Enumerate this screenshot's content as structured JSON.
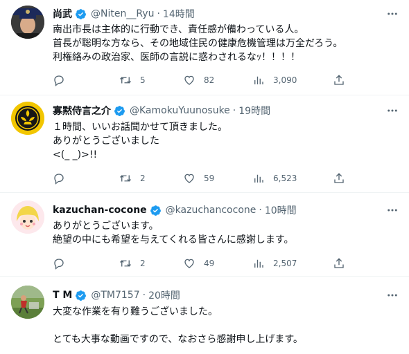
{
  "tweets": [
    {
      "name": "尚武",
      "handle": "@Niten__Ryu",
      "sep": "·",
      "time": "14時間",
      "lines": [
        "南出市長は主体的に行動でき、責任感が備わっている人。",
        "首長が聡明な方なら、その地域住民の健康危機管理は万全だろう。",
        "利権絡みの政治家、医師の言説に惑わされるなｯ！！！！"
      ],
      "replies": "",
      "retweets": "5",
      "likes": "82",
      "views": "3,090"
    },
    {
      "name": "寡黙侍言之介",
      "handle": "@KamokuYuunosuke",
      "sep": "·",
      "time": "19時間",
      "lines": [
        "１時間、いいお話聞かせて頂きました。",
        "ありがとうございました",
        "<(_ _)>!!"
      ],
      "replies": "",
      "retweets": "2",
      "likes": "59",
      "views": "6,523"
    },
    {
      "name": "kazuchan-cocone",
      "handle": "@kazuchancocone",
      "sep": "·",
      "time": "10時間",
      "lines": [
        "ありがとうございます。",
        "絶望の中にも希望を与えてくれる皆さんに感謝します。"
      ],
      "replies": "",
      "retweets": "2",
      "likes": "49",
      "views": "2,507"
    },
    {
      "name": "T M",
      "handle": "@TM7157",
      "sep": "·",
      "time": "20時間",
      "lines": [
        "大変な作業を有り難うございました。",
        "",
        "とても大事な動画ですので、なおさら感謝申し上げます。"
      ]
    }
  ],
  "icons": {
    "verified": "verified-badge-icon",
    "more": "more-icon",
    "reply": "reply-icon",
    "retweet": "retweet-icon",
    "like": "like-icon",
    "views": "views-icon",
    "share": "share-icon"
  },
  "colors": {
    "verified": "#1d9bf0",
    "text": "#0f1419",
    "muted": "#536471",
    "divider": "#eff3f4"
  }
}
